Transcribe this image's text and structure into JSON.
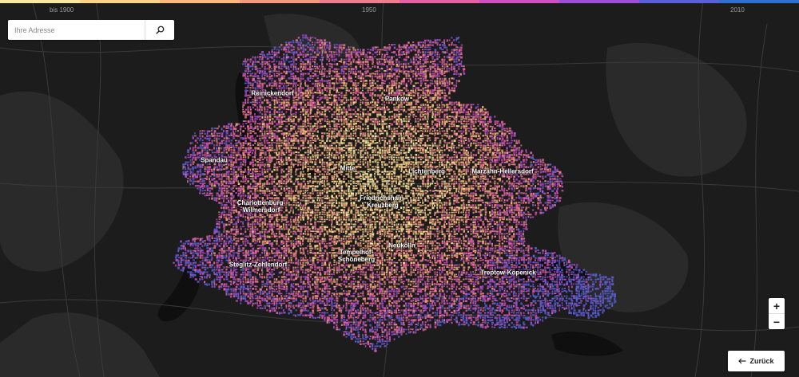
{
  "timeline": {
    "colors": [
      "#fbe9a3",
      "#fcd487",
      "#f9b97c",
      "#f49a7e",
      "#ee7d8d",
      "#e561a3",
      "#cf4fc0",
      "#9b4fd6",
      "#5b5fd8",
      "#2f6fd0"
    ],
    "labels": [
      "bis 1900",
      "1950",
      "2010"
    ]
  },
  "search": {
    "placeholder": "Ihre Adresse",
    "icon": "search-icon"
  },
  "zoom": {
    "in_label": "+",
    "out_label": "−"
  },
  "back": {
    "label": "Zurück",
    "icon": "arrow-left-icon"
  },
  "districts": [
    {
      "name": "Reinickendorf"
    },
    {
      "name": "Pankow"
    },
    {
      "name": "Spandau"
    },
    {
      "name": "Mitte"
    },
    {
      "name": "Lichtenberg"
    },
    {
      "name": "Marzahn-Hellersdorf"
    },
    {
      "name": "Friedrichshain-\nKreuzberg"
    },
    {
      "name": "Charlottenburg-\nWilmersdorf"
    },
    {
      "name": "Neukölln"
    },
    {
      "name": "Tempelhof-\nSchöneberg"
    },
    {
      "name": "Steglitz-Zehlendorf"
    },
    {
      "name": "Treptow-Köpenick"
    }
  ]
}
